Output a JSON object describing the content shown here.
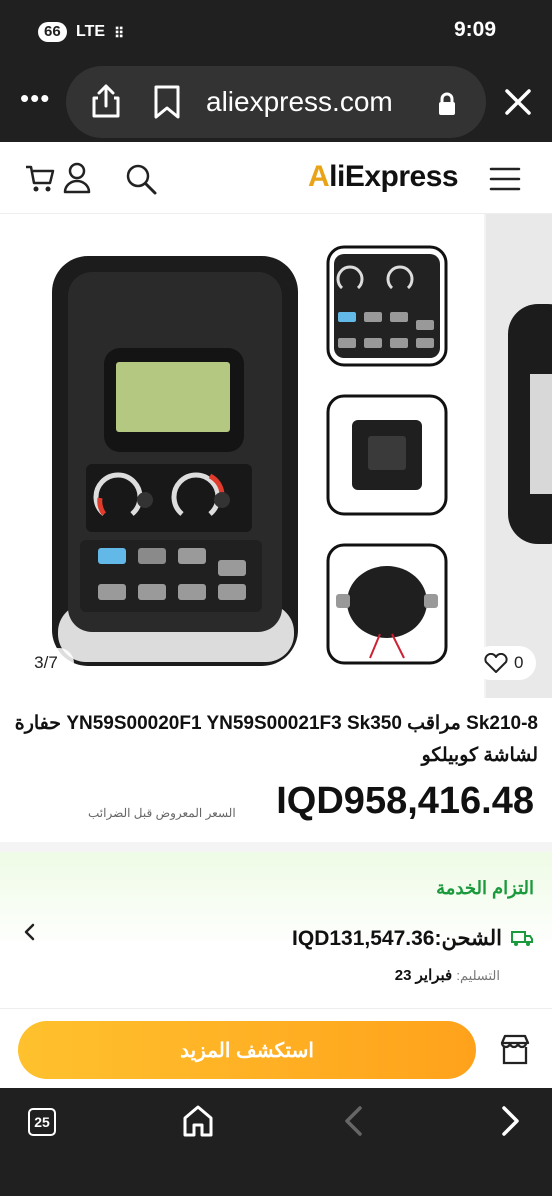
{
  "status_bar": {
    "signal_badge": "66",
    "network": "LTE",
    "indicator": "⠿",
    "time": "9:09"
  },
  "browser": {
    "more": "•••",
    "url": "aliexpress.com",
    "icons": [
      "share-icon",
      "bookmark-icon",
      "lock-icon",
      "close-icon"
    ]
  },
  "header": {
    "logo_mark": "A",
    "logo_rest": "liExpress",
    "icons": [
      "cart-icon",
      "user-icon",
      "search-icon",
      "menu-icon"
    ]
  },
  "gallery": {
    "counter": "3/7",
    "wishlist_count": "0"
  },
  "product": {
    "title": "Sk210-8 مراقب YN59S00020F1 YN59S00021F3 Sk350 حفارة لشاشة كوبيلكو",
    "price": "IQD958,416.48",
    "tax_note": "السعر المعروض قبل الضرائب"
  },
  "service": {
    "title": "التزام الخدمة",
    "shipping": "الشحن:IQD131,547.36",
    "delivery_label": "التسليم:",
    "delivery_date": "فبراير 23"
  },
  "action": {
    "explore_label": "استكشف المزيد"
  },
  "toolbar": {
    "tab_count": "25"
  },
  "colors": {
    "brand_orange": "#ffa21b",
    "service_green": "#1a9a3c",
    "dark_chrome": "#202020"
  }
}
